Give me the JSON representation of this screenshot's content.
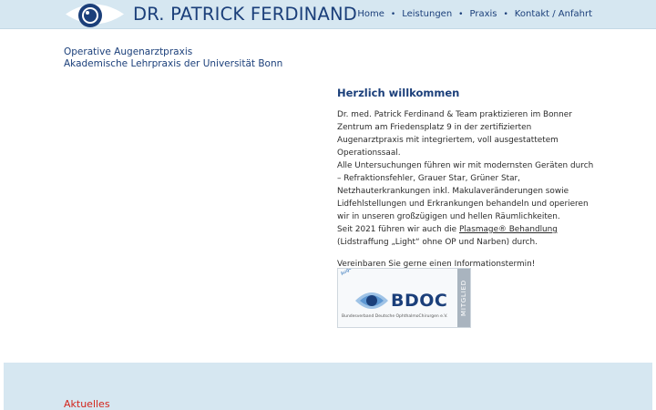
{
  "header": {
    "title": "DR. PATRICK FERDINAND",
    "nav": [
      {
        "label": "Home"
      },
      {
        "label": "Leistungen"
      },
      {
        "label": "Praxis"
      },
      {
        "label": "Kontakt / Anfahrt"
      }
    ],
    "nav_separator": "•"
  },
  "practice": {
    "line1": "Operative Augenarztpraxis",
    "line2": "Akademische Lehrpraxis der Universität Bonn"
  },
  "main": {
    "heading": "Herzlich willkommen",
    "p1": "Dr. med. Patrick Ferdinand & Team praktizieren im Bonner Zentrum am Friedensplatz 9 in der zertifizierten Augenarztpraxis mit integriertem, voll ausgestattetem Operationssaal.",
    "p2": "Alle Untersuchungen führen wir mit modernsten Geräten durch – Refraktionsfehler, Grauer Star, Grüner Star, Netzhauterkrankungen inkl. Makulaveränderungen sowie Lidfehlstellungen und Erkrankungen behandeln und operieren wir in unseren großzügigen und hellen Räumlichkeiten.",
    "p3_before": "Seit 2021 führen wir auch die ",
    "p3_link": "Plasmage® Behandlung",
    "p3_after": " (Lidstraffung „Light“ ohne OP und Narben) durch.",
    "cta": "Vereinbaren Sie gerne einen Informationstermin!"
  },
  "badge": {
    "arc_text": "Augenoperationen im Fokus",
    "name": "BDOC",
    "subtitle": "Bundesverband Deutsche OphthalmoChirurgen e.V.",
    "side_label": "MITGLIED"
  },
  "news": {
    "heading": "Aktuelles"
  },
  "colors": {
    "brand_blue": "#1b3f7a",
    "header_bg": "#d6e7f1",
    "accent_red": "#d3241b"
  }
}
